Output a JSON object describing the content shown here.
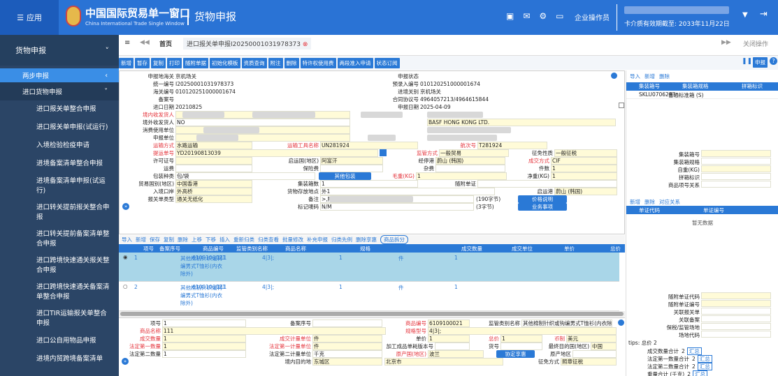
{
  "topbar": {
    "apps": "应用",
    "title": "中国国际贸易单一窗口",
    "subtitle": "China International Trade Single Window",
    "module": "货物申报",
    "user": "企业操作员",
    "expire": "卡介质有效期截至: 2033年11月22日"
  },
  "sidebar": {
    "head": "货物申报",
    "active": "两步申报",
    "group": "进口货物申报",
    "items": [
      "进口报关单整合申报",
      "进口报关单申报(试运行)",
      "入境检验检疫申请",
      "进境备案清单整合申报",
      "进境备案清单申报(试运行)",
      "进口转关提前报关整合申报",
      "进口转关提前备案清单整合申报",
      "进口跨境快速通关报关整合申报",
      "进口跨境快速通关备案清单整合申报",
      "进口TIR运输报关单整合申报",
      "进口公自用物品申报",
      "进境内贸跨境备案清单"
    ]
  },
  "tabs": {
    "home": "首页",
    "current": "进口报关单申报I20250001031978373",
    "close_ops": "关闭操作"
  },
  "toolbar": [
    "新增",
    "暂存",
    "复制",
    "打印",
    "随附单据",
    "初始化模板",
    "资质查询",
    "附注",
    "删除",
    "特许权使用费",
    "两段准入申请",
    "状态订阅"
  ],
  "toolbar_right": "申报",
  "form": {
    "rows": [
      {
        "lbl": "申报地海关",
        "val": "京机场关",
        "lbl2": "申报状态",
        "val2": ""
      },
      {
        "lbl": "统一编号",
        "val": "I20250001031978373",
        "lbl2": "预录入编号",
        "val2": "010120251000001674"
      },
      {
        "lbl": "海关编号",
        "val": "010120251000001674",
        "lbl2": "进境关别",
        "val2": "京机场关"
      },
      {
        "lbl": "备案号",
        "val": "",
        "lbl2": "合同协议号",
        "val2": "4964057213/4964615844"
      },
      {
        "lbl": "进口日期",
        "val": "20210825",
        "lbl2": "申报日期",
        "val2": "2025-04-09"
      }
    ],
    "consignee": "境内收发货人",
    "overseas": "境外收发货人",
    "overseas_val": "NO",
    "overseas_name": "BASF HONG KONG LTD.",
    "consumer": "消费使用单位",
    "declarant": "申报单位",
    "transport_lbl": "运输方式",
    "transport": "水路运输",
    "vessel_lbl": "运输工具名称",
    "vessel": "UN281924",
    "voyage_lbl": "航次号",
    "voyage": "T281924",
    "bl_lbl": "提运单号",
    "bl": "YD20190813039",
    "supervision_lbl": "监管方式",
    "supervision": "一般贸易",
    "tax_lbl": "征免性质",
    "tax": "一般征税",
    "license_lbl": "许可证号",
    "origin_country_lbl": "启运国(地区)",
    "origin_country": "阿富汗",
    "port_lbl": "经停港",
    "port": "蔚山 (韩国)",
    "deal_lbl": "成交方式",
    "deal": "CIF",
    "freight_lbl": "运费",
    "insurance_lbl": "保险费",
    "misc_lbl": "杂费",
    "pieces_lbl": "件数",
    "pieces": "1",
    "pack_lbl": "包装种类",
    "pack": "包/袋",
    "other_pack": "其他包装",
    "gross_lbl": "毛重(KG)",
    "gross": "1",
    "net_lbl": "净重(KG)",
    "net": "1",
    "trade_country_lbl": "贸易国别(地区)",
    "trade_country": "中国香港",
    "container_lbl": "集装箱数",
    "container": "1",
    "attached_lbl": "随附单证",
    "entry_port_lbl": "入境口岸",
    "entry_port": "外高桥",
    "goods_loc_lbl": "货物存放地点",
    "goods_loc": "外1",
    "dep_port_lbl": "启运港",
    "dep_port": "蔚山 (韩国)",
    "decl_type_lbl": "报关单类型",
    "decl_type": "通关无纸化",
    "remark_lbl": "备注",
    "remark": ">,附原厂商发票号",
    "price_btn": "价格说明",
    "mark_lbl": "标记唛码",
    "mark": "N/M",
    "biz_btn": "业务事项",
    "c190": "(190字节)",
    "c3": "(3字节)"
  },
  "goods_tool": [
    "导入",
    "新增",
    "保存",
    "复制",
    "删除",
    "上移",
    "下移",
    "插入",
    "重新归类",
    "归类查看",
    "批量修改",
    "补充申报",
    "归类先例",
    "删除享惠"
  ],
  "goods_split": "商品拆分",
  "goods_head": [
    "项号",
    "备案序号",
    "商品编号",
    "监管类别名称",
    "商品名称",
    "规格",
    "成交数量",
    "成交单位",
    "单价",
    "总价"
  ],
  "goods": [
    {
      "no": "1",
      "code": "6109100021",
      "cat": "其他棉制针织或钩编男式T恤衫(内衣除外)",
      "name": "111",
      "spec": "4|3|;",
      "qty": "1",
      "unit": "件",
      "price": "1"
    },
    {
      "no": "2",
      "code": "6109100021",
      "cat": "其他棉制针织或钩编男式T恤衫(内衣除外)",
      "name": "111",
      "spec": "4|3|;",
      "qty": "1",
      "unit": "件",
      "price": "1"
    }
  ],
  "lower": {
    "item_lbl": "项号",
    "item": "1",
    "record_lbl": "备案序号",
    "code_lbl": "商品编号",
    "code": "6109100021",
    "cat_lbl": "监管类别名称",
    "cat": "其他棉制针织或钩编男式T恤衫(内衣除外)",
    "name_lbl": "商品名称",
    "name": "111",
    "spec_lbl": "规格型号",
    "spec": "4|3|;",
    "qty_lbl": "成交数量",
    "qty": "1",
    "unit_lbl": "成交计量单位",
    "unit": "件",
    "price_lbl": "单价",
    "price": "1",
    "total_lbl": "总价",
    "total": "1",
    "cur_lbl": "币制",
    "cur": "美元",
    "q1_lbl": "法定第一数量",
    "q1": "1",
    "u1_lbl": "法定第一计量单位",
    "u1": "件",
    "ver_lbl": "加工成品单耗版本号",
    "goodsno_lbl": "货号",
    "dest_lbl": "最终目的国(地区)",
    "dest": "中国",
    "q2_lbl": "法定第二数量",
    "q2": "1",
    "u2_lbl": "法定第二计量单位",
    "u2": "千克",
    "origin_lbl": "原产国(地区)",
    "origin": "波兰",
    "agree_btn": "协定享惠",
    "orig_area_lbl": "原产地区",
    "dest_area_lbl": "境内目的地",
    "dest_area": "东城区",
    "city": "北京市",
    "levy_lbl": "征免方式",
    "levy": "照章征税"
  },
  "right": {
    "tool": [
      "导入",
      "新增",
      "删除"
    ],
    "container_head": [
      "集装箱号",
      "集装箱规格",
      "拼箱标识"
    ],
    "container_row": "SKLU0706283",
    "container_spec": "普通标准箱 (S)",
    "fields": [
      "集装箱号",
      "集装箱规格",
      "自重(KG)",
      "拼箱标识",
      "商品项号关系"
    ],
    "cert_tool": [
      "新增",
      "删除",
      "对应关系"
    ],
    "cert_head": [
      "单证代码",
      "单证编号"
    ],
    "no_data": "暂无数据",
    "attach_fields": [
      "随附单证代码",
      "随附单证编号",
      "关联报关单",
      "关联备案",
      "保税/监管场地",
      "场地代码"
    ],
    "tips": "tips: 总价 2",
    "sums": [
      {
        "l": "成交数量合计",
        "v": "2"
      },
      {
        "l": "法定第一数量合计",
        "v": "2"
      },
      {
        "l": "法定第二数量合计",
        "v": "2"
      },
      {
        "l": "重量合计 (千克)",
        "v": "2"
      }
    ],
    "sum_btn": "汇总"
  }
}
